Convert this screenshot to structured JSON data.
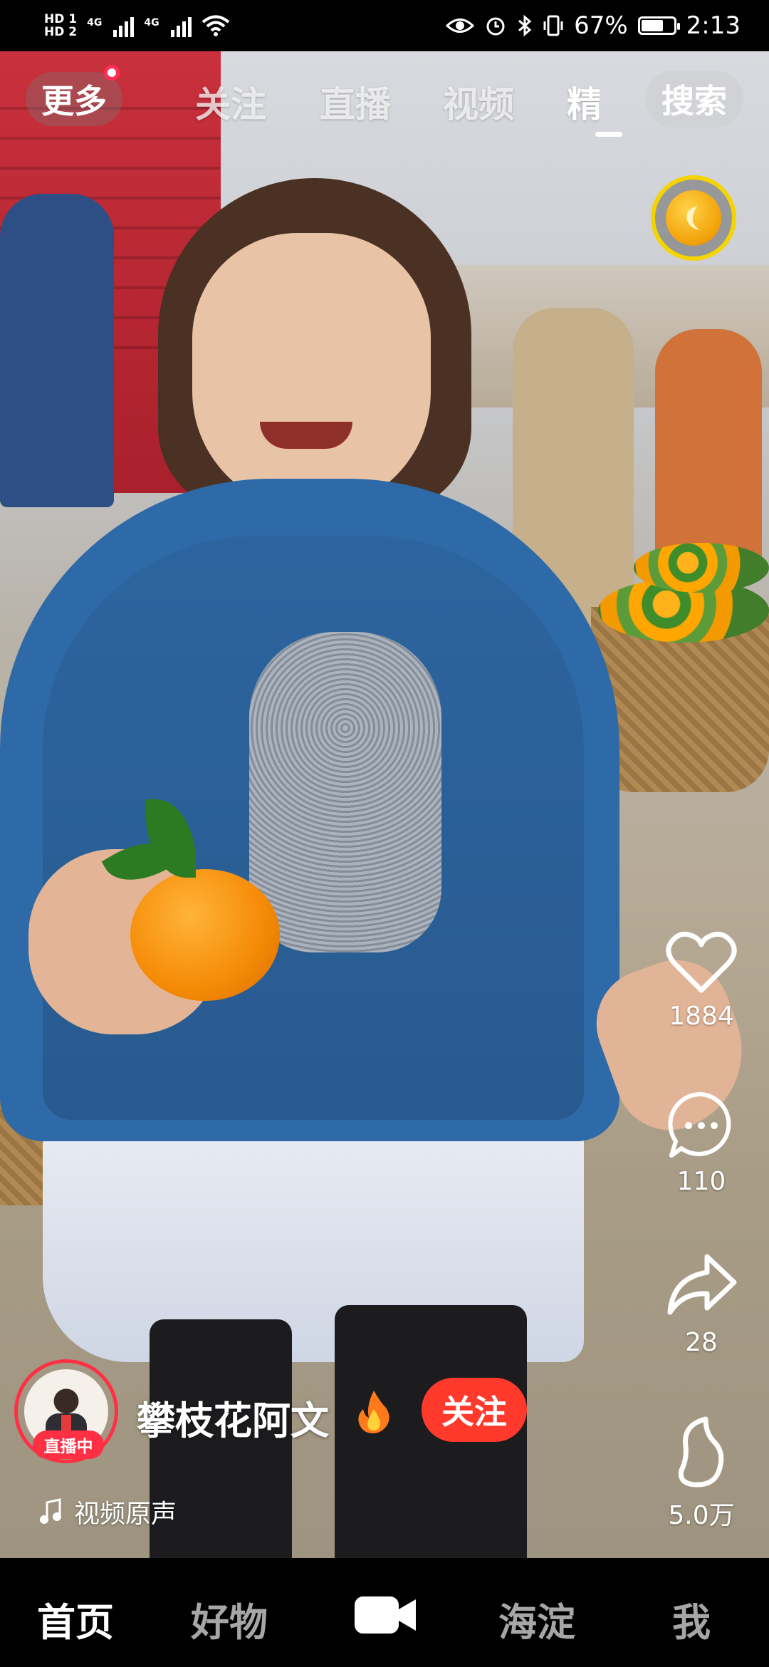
{
  "status_bar": {
    "hd1": "HD 1",
    "hd2": "HD 2",
    "network1": "4G",
    "network2": "4G",
    "battery": "67%",
    "time": "2:13"
  },
  "top_nav": {
    "more_label": "更多",
    "tabs": [
      "关注",
      "直播",
      "视频",
      "精"
    ],
    "active_tab_index": 3,
    "search_label": "搜索"
  },
  "actions": {
    "likes": "1884",
    "comments": "110",
    "shares": "28",
    "collects": "5.0万"
  },
  "author": {
    "name": "攀枝花阿文",
    "live_badge": "直播中",
    "follow_label": "关注"
  },
  "music": {
    "label": "视频原声"
  },
  "bottom_nav": {
    "items": [
      "首页",
      "好物",
      "海淀",
      "我"
    ],
    "active_index": 0
  },
  "colors": {
    "accent_red": "#ff3a2d",
    "live_red": "#ff2f44",
    "coin_ring": "#f5d400"
  }
}
